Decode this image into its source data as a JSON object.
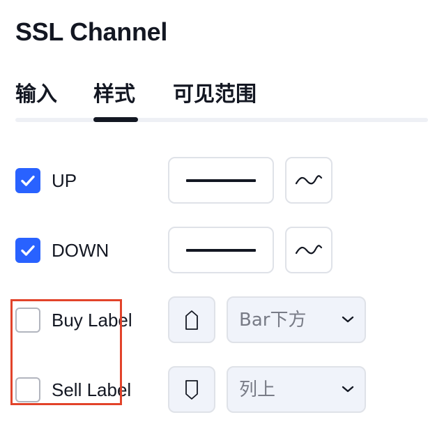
{
  "dialog": {
    "title": "SSL Channel"
  },
  "tabs": [
    {
      "label": "输入"
    },
    {
      "label": "样式"
    },
    {
      "label": "可见范围"
    }
  ],
  "active_tab": "样式",
  "rows": [
    {
      "label": "UP",
      "checked": true,
      "control": "line-style"
    },
    {
      "label": "DOWN",
      "checked": true,
      "control": "line-style"
    },
    {
      "label": "Buy Label",
      "checked": false,
      "control": "shape",
      "shape_icon": "label-up-icon",
      "select_value": "Bar下方"
    },
    {
      "label": "Sell Label",
      "checked": false,
      "control": "shape",
      "shape_icon": "label-down-icon",
      "select_value": "列上"
    }
  ],
  "colors": {
    "accent": "#2962ff",
    "text": "#131722",
    "muted": "#787b86",
    "highlight": "#e2432a"
  }
}
